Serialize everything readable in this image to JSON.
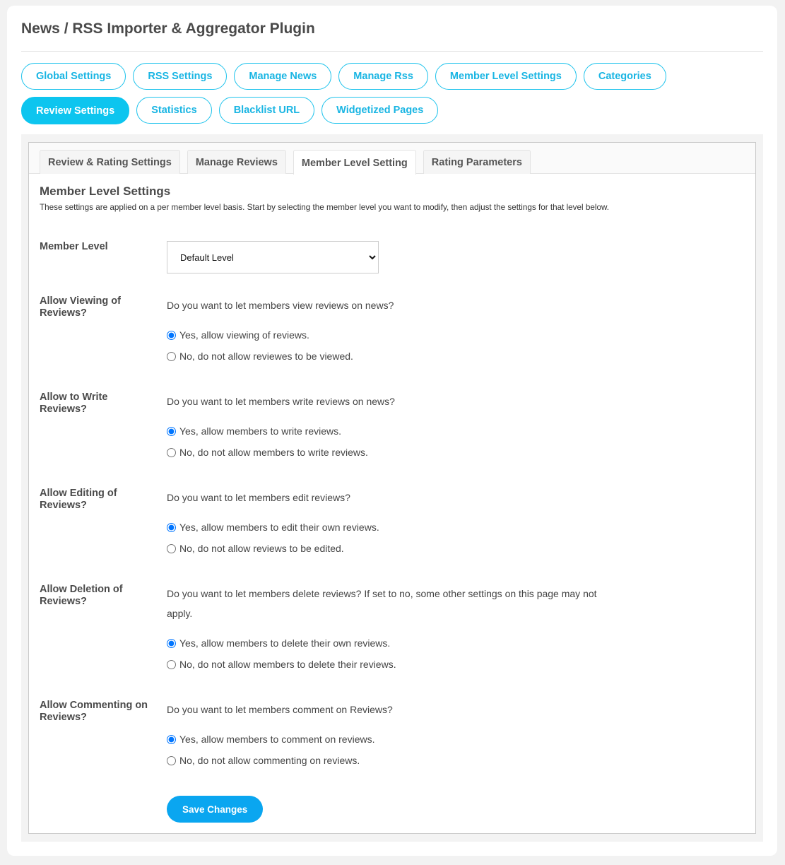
{
  "header": {
    "title": "News / RSS Importer & Aggregator Plugin"
  },
  "nav": {
    "active": "Review Settings",
    "items": [
      {
        "label": "Global Settings"
      },
      {
        "label": "RSS Settings"
      },
      {
        "label": "Manage News"
      },
      {
        "label": "Manage Rss"
      },
      {
        "label": "Member Level Settings"
      },
      {
        "label": "Categories"
      },
      {
        "label": "Review Settings"
      },
      {
        "label": "Statistics"
      },
      {
        "label": "Blacklist URL"
      },
      {
        "label": "Widgetized Pages"
      }
    ]
  },
  "tabs": {
    "active": "Member Level Setting",
    "items": [
      {
        "label": "Review & Rating Settings"
      },
      {
        "label": "Manage Reviews"
      },
      {
        "label": "Member Level Setting"
      },
      {
        "label": "Rating Parameters"
      }
    ]
  },
  "section": {
    "title": "Member Level Settings",
    "description": "These settings are applied on a per member level basis. Start by selecting the member level you want to modify, then adjust the settings for that level below."
  },
  "member_level": {
    "label": "Member Level",
    "selected": "Default Level"
  },
  "settings": [
    {
      "label": "Allow Viewing of Reviews?",
      "question": "Do you want to let members view reviews on news?",
      "selected": "yes",
      "options": [
        {
          "value": "yes",
          "label": "Yes, allow viewing of reviews."
        },
        {
          "value": "no",
          "label": "No, do not allow reviewes to be viewed."
        }
      ]
    },
    {
      "label": "Allow to Write Reviews?",
      "question": "Do you want to let members write reviews on news?",
      "selected": "yes",
      "options": [
        {
          "value": "yes",
          "label": "Yes, allow members to write reviews."
        },
        {
          "value": "no",
          "label": "No, do not allow members to write reviews."
        }
      ]
    },
    {
      "label": "Allow Editing of Reviews?",
      "question": "Do you want to let members edit reviews?",
      "selected": "yes",
      "options": [
        {
          "value": "yes",
          "label": "Yes, allow members to edit their own reviews."
        },
        {
          "value": "no",
          "label": "No, do not allow reviews to be edited."
        }
      ]
    },
    {
      "label": "Allow Deletion of Reviews?",
      "question": "Do you want to let members delete reviews? If set to no, some other settings on this page may not apply.",
      "selected": "yes",
      "options": [
        {
          "value": "yes",
          "label": "Yes, allow members to delete their own reviews."
        },
        {
          "value": "no",
          "label": "No, do not allow members to delete their reviews."
        }
      ]
    },
    {
      "label": "Allow Commenting on Reviews?",
      "question": "Do you want to let members comment on Reviews?",
      "selected": "yes",
      "options": [
        {
          "value": "yes",
          "label": "Yes, allow members to comment on reviews."
        },
        {
          "value": "no",
          "label": "No, do not allow commenting on reviews."
        }
      ]
    }
  ],
  "save_label": "Save Changes",
  "colors": {
    "accent": "#0dc5ef",
    "accent_text": "#19b5e3",
    "save_button": "#0aa6f0",
    "radio_checked": "#0075ff"
  }
}
